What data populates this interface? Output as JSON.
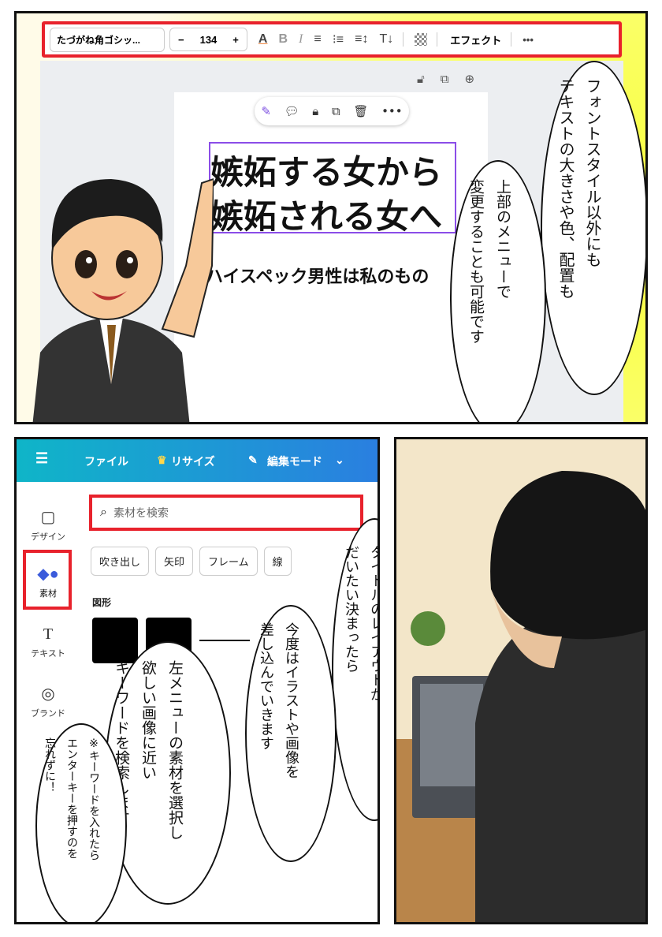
{
  "top_panel": {
    "toolbar": {
      "font_name": "たづがね角ゴシッ...",
      "minus": "−",
      "font_size": "134",
      "plus": "+",
      "text_color_icon": "A",
      "bold_icon": "B",
      "italic_icon": "I",
      "align_icon": "≡",
      "list_icon": "⁝≡",
      "spacing_icon": "≡↕",
      "vertical_text_icon": "T↓",
      "effect_label": "エフェクト",
      "more_icon": "•••"
    },
    "canvas": {
      "title_line1": "嫉妬する女から",
      "title_line2": "嫉妬される女へ",
      "subtitle": "ハイスペック男性は私のもの"
    },
    "bubble_right": "フォントスタイル以外にも テキストの大きさや色、配置も",
    "bubble_right_lines": [
      "フォントスタイル以外にも",
      "テキストの大きさや色、配置も"
    ],
    "bubble_mid_lines": [
      "上部のメニューで",
      "変更することも可能です"
    ]
  },
  "left_panel": {
    "topbar": {
      "menu_icon": "☰",
      "file_label": "ファイル",
      "resize_label": "リサイズ",
      "edit_mode_label": "編集モード"
    },
    "sidebar": [
      {
        "icon": "▢",
        "label": "デザイン"
      },
      {
        "icon": "◆●",
        "label": "素材"
      },
      {
        "icon": "T",
        "label": "テキスト"
      },
      {
        "icon": "◎",
        "label": "ブランド"
      }
    ],
    "search_placeholder": "素材を検索",
    "chips": [
      "吹き出し",
      "矢印",
      "フレーム",
      "線"
    ],
    "section_shapes": "図形",
    "bubble_a_lines": [
      "タイトルのレイアウトが",
      "だいたい決まったら"
    ],
    "bubble_b_lines": [
      "今度はイラストや画像を",
      "差し込んでいきます"
    ],
    "bubble_c_lines": [
      "左メニューの素材を選択し",
      "欲しい画像に近い",
      "キーワードを検索します"
    ],
    "bubble_d_lines": [
      "※キーワードを入れたら",
      "エンターキーを押すのを",
      "忘れずに！"
    ]
  },
  "colors": {
    "highlight_red": "#e8222c",
    "canva_gradient_start": "#0fb5c8",
    "canva_gradient_end": "#2a7fe0",
    "selection_purple": "#8b4de8"
  }
}
